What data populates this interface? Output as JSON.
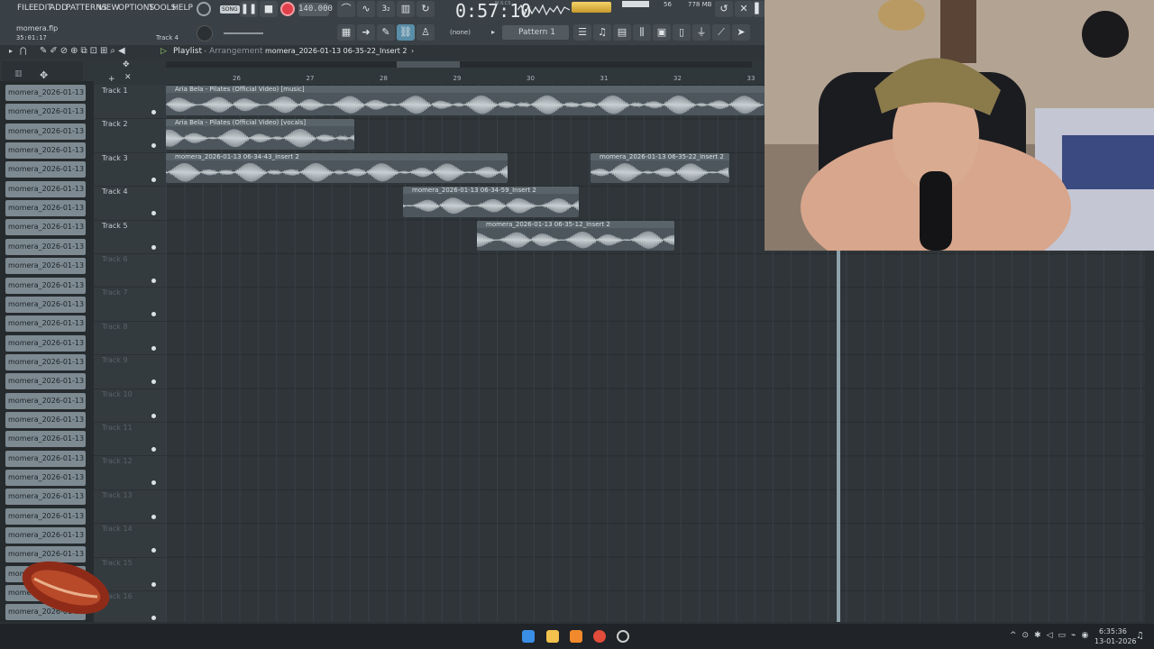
{
  "menu": [
    "FILE",
    "EDIT",
    "ADD",
    "PATTERNS",
    "VIEW",
    "OPTIONS",
    "TOOLS",
    "HELP"
  ],
  "transport": {
    "mode": "SONG",
    "tempo": "140.000",
    "time": "0:57:10",
    "time_label": "M:S:CS",
    "cpu": "56",
    "memory": "778 MB"
  },
  "project": {
    "file": "momera.flp",
    "position": "35:01:17",
    "hint_track": "Track 4"
  },
  "pattern": {
    "none": "(none)",
    "name": "Pattern 1"
  },
  "playlist": {
    "title": "Playlist",
    "subtitle": "Arrangement",
    "selected_clip": "momera_2026-01-13 06-35-22_Insert 2"
  },
  "ruler": [
    "26",
    "27",
    "28",
    "29",
    "30",
    "31",
    "32",
    "33"
  ],
  "tracks": [
    "Track 1",
    "Track 2",
    "Track 3",
    "Track 4",
    "Track 5",
    "Track 6",
    "Track 7",
    "Track 8",
    "Track 9",
    "Track 10",
    "Track 11",
    "Track 12",
    "Track 13",
    "Track 14",
    "Track 15",
    "Track 16"
  ],
  "browser_items": [
    "momera_2026-01-13 06...",
    "momera_2026-01-13 06...",
    "momera_2026-01-13 06...",
    "momera_2026-01-13 06...",
    "momera_2026-01-13 06...",
    "momera_2026-01-13 06...",
    "momera_2026-01-13 06...",
    "momera_2026-01-13 06...",
    "momera_2026-01-13 06...",
    "momera_2026-01-13 06...",
    "momera_2026-01-13 06...",
    "momera_2026-01-13 06...",
    "momera_2026-01-13 06...",
    "momera_2026-01-13 06...",
    "momera_2026-01-13 06...",
    "momera_2026-01-13 06...",
    "momera_2026-01-13 06...",
    "momera_2026-01-13 06...",
    "momera_2026-01-13 06...",
    "momera_2026-01-13 06...",
    "momera_2026-01-13 06...",
    "momera_2026-01-13 06...",
    "momera_2026-01-13 06...",
    "momera_2026-01-13 06...",
    "momera_2026-01-13 06...",
    "momera_2026-01-13 06...",
    "momera_2026-01-13 06...",
    "momera_2026-01-13 06..."
  ],
  "clips": [
    {
      "name": "Aria Bela - Pilates (Official Video) [music]",
      "track": 1
    },
    {
      "name": "Aria Bela - Pilates (Official Video) [vocals]",
      "track": 2
    },
    {
      "name": "momera_2026-01-13 06-34-43_Insert 2",
      "track": 3
    },
    {
      "name": "momera_2026-01-13 06-35-22_Insert 2",
      "track": 3
    },
    {
      "name": "momera_2026-01-13 06-34-59_Insert 2",
      "track": 4
    },
    {
      "name": "momera_2026-01-13 06-35-12_Insert 2",
      "track": 5
    }
  ],
  "taskbar": {
    "time": "6:35:36",
    "date": "13-01-2026"
  },
  "colors": {
    "accent_green": "#9fd46a",
    "record_red": "#e0404b",
    "clip": "#4c565c"
  }
}
